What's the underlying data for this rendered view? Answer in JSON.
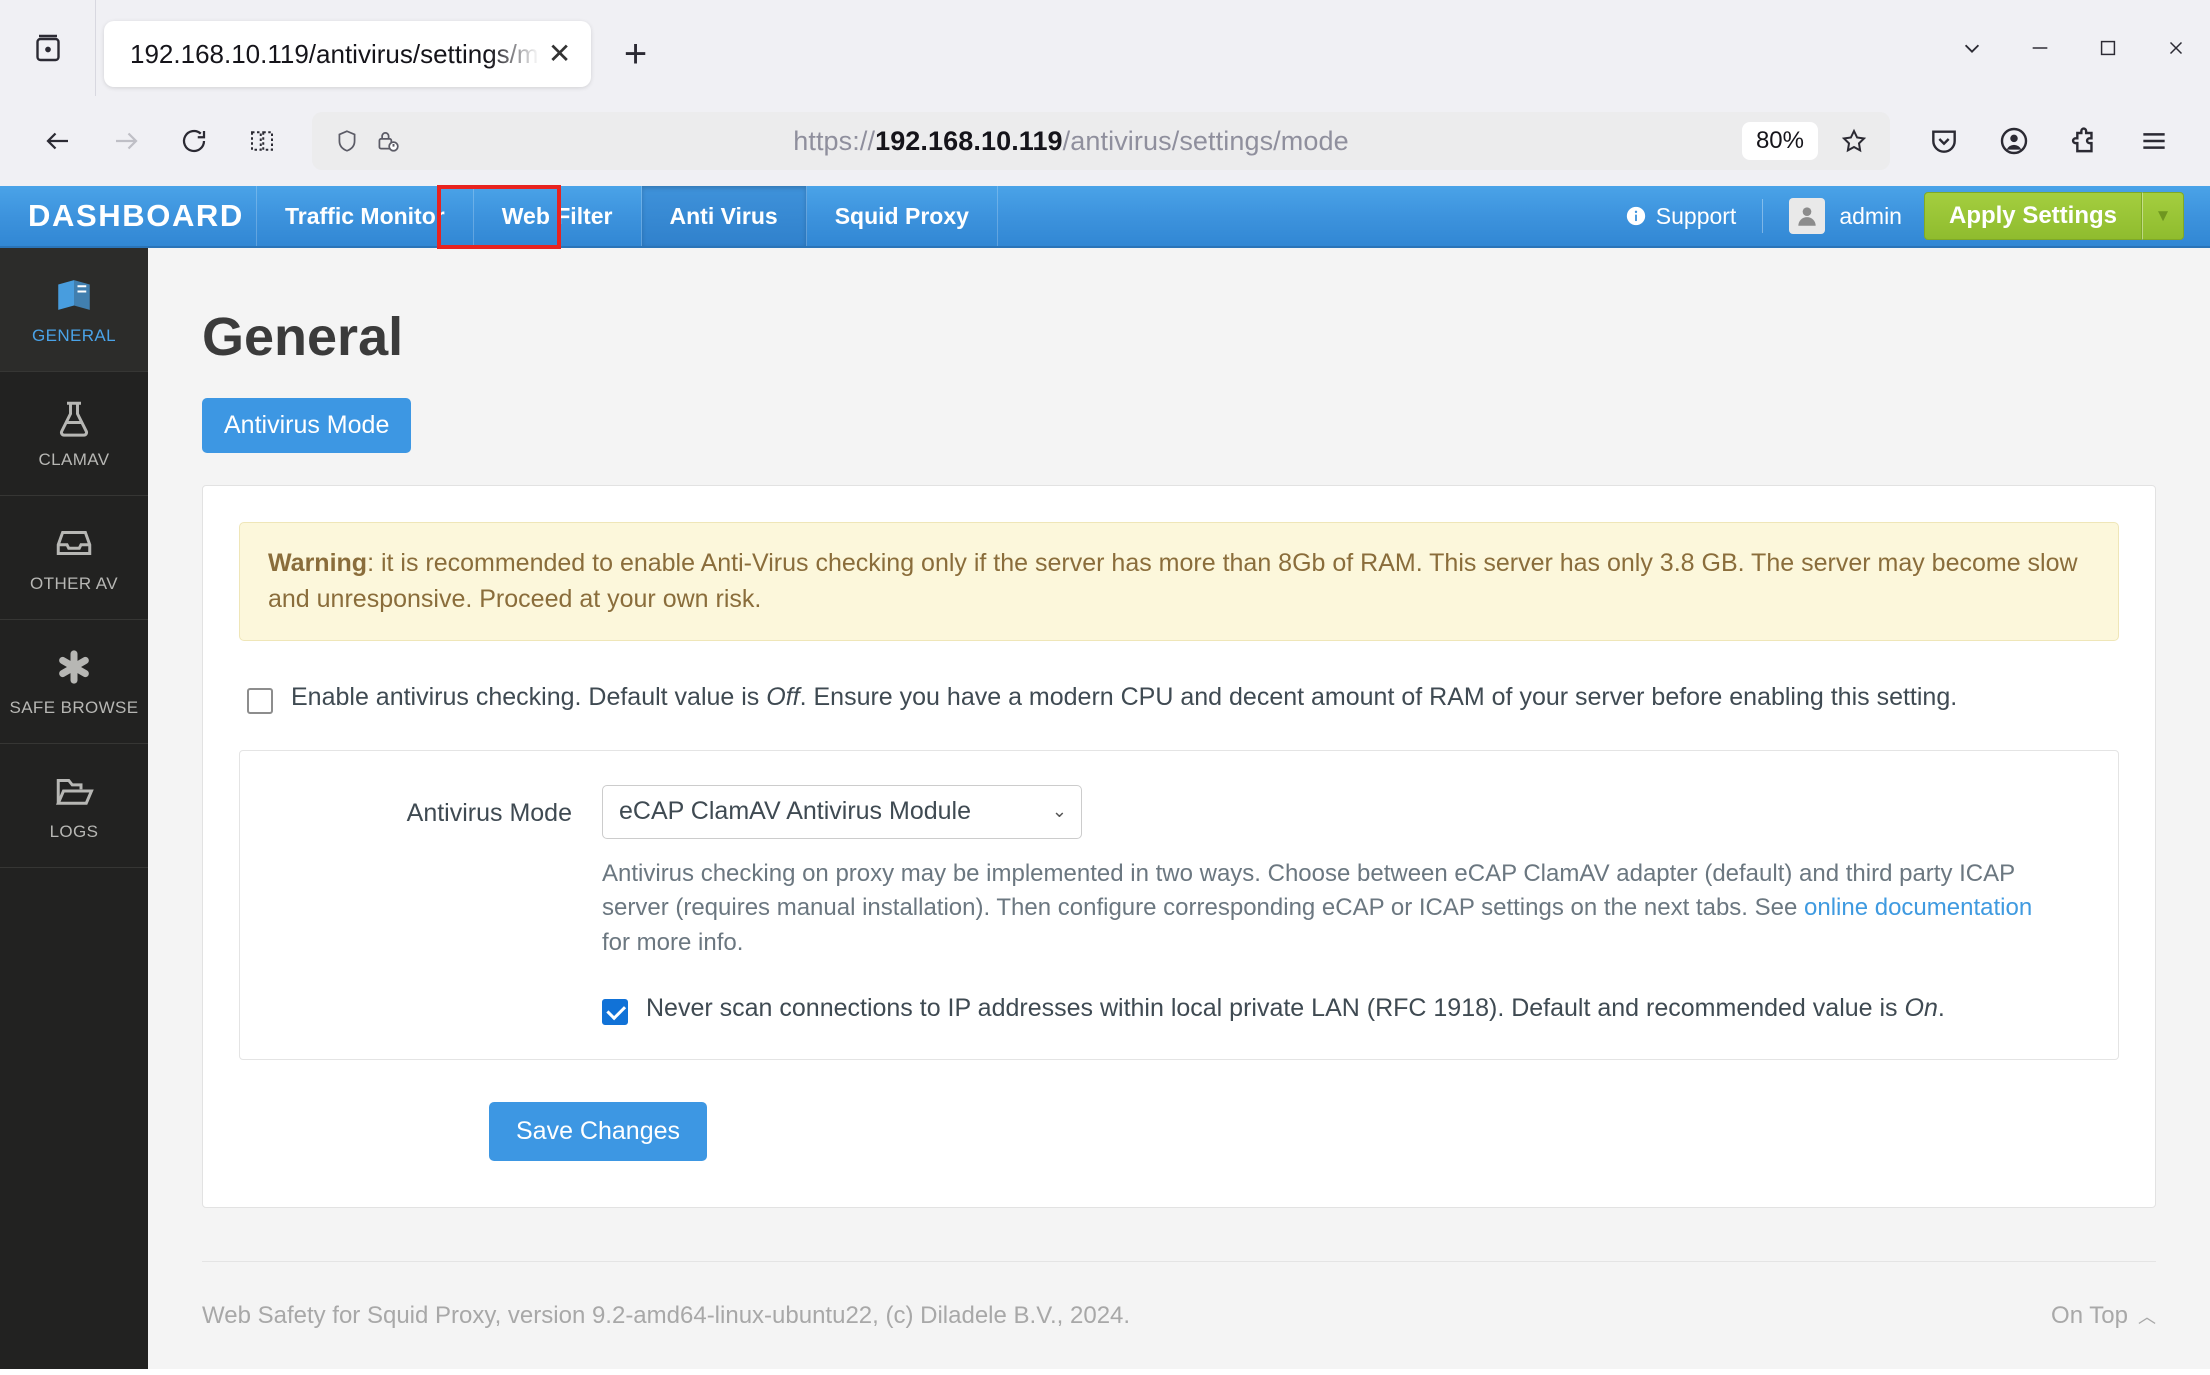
{
  "browser": {
    "tab": {
      "title": "192.168.10.119/antivirus/settings/m",
      "close_label": "✕"
    },
    "new_tab_label": "+",
    "url": {
      "scheme": "https://",
      "host": "192.168.10.119",
      "path": "/antivirus/settings/mode"
    },
    "zoom": "80%",
    "window": {
      "minimize": "─",
      "maximize": "□",
      "close": "✕"
    }
  },
  "topnav": {
    "brand": "DASHBOARD",
    "items": [
      {
        "label": "Traffic Monitor",
        "active": false
      },
      {
        "label": "Web Filter",
        "active": false
      },
      {
        "label": "Anti Virus",
        "active": true
      },
      {
        "label": "Squid Proxy",
        "active": false
      }
    ],
    "support_label": "Support",
    "user": "admin",
    "apply_label": "Apply Settings",
    "highlight_color": "#e8231f"
  },
  "sidebar": {
    "items": [
      {
        "label": "GENERAL",
        "icon": "book-icon",
        "active": true
      },
      {
        "label": "CLAMAV",
        "icon": "flask-icon",
        "active": false
      },
      {
        "label": "OTHER AV",
        "icon": "inbox-icon",
        "active": false
      },
      {
        "label": "SAFE BROWSE",
        "icon": "asterisk-icon",
        "active": false
      },
      {
        "label": "LOGS",
        "icon": "folder-icon",
        "active": false
      }
    ]
  },
  "page": {
    "title": "General",
    "tab_label": "Antivirus Mode",
    "warning": {
      "prefix": "Warning",
      "text": ": it is recommended to enable Anti-Virus checking only if the server has more than 8Gb of RAM. This server has only 3.8 GB. The server may become slow and unresponsive. Proceed at your own risk."
    },
    "enable_checkbox": {
      "checked": false,
      "text_before": "Enable antivirus checking. Default value is ",
      "emphasis": "Off",
      "text_after": ". Ensure you have a modern CPU and decent amount of RAM of your server before enabling this setting."
    },
    "mode_field": {
      "label": "Antivirus Mode",
      "value": "eCAP ClamAV Antivirus Module",
      "help_part1": "Antivirus checking on proxy may be implemented in two ways. Choose between eCAP ClamAV adapter (default) and third party ICAP server (requires manual installation). Then configure corresponding eCAP or ICAP settings on the next tabs. See ",
      "help_link": "online documentation",
      "help_part2": " for more info."
    },
    "never_scan_checkbox": {
      "checked": true,
      "text_before": "Never scan connections to IP addresses within local private LAN (RFC 1918). Default and recommended value is ",
      "emphasis": "On",
      "text_after": "."
    },
    "save_label": "Save Changes",
    "footer_text": "Web Safety for Squid Proxy, version 9.2-amd64-linux-ubuntu22, (c) Diladele B.V., 2024.",
    "on_top_label": "On Top"
  }
}
